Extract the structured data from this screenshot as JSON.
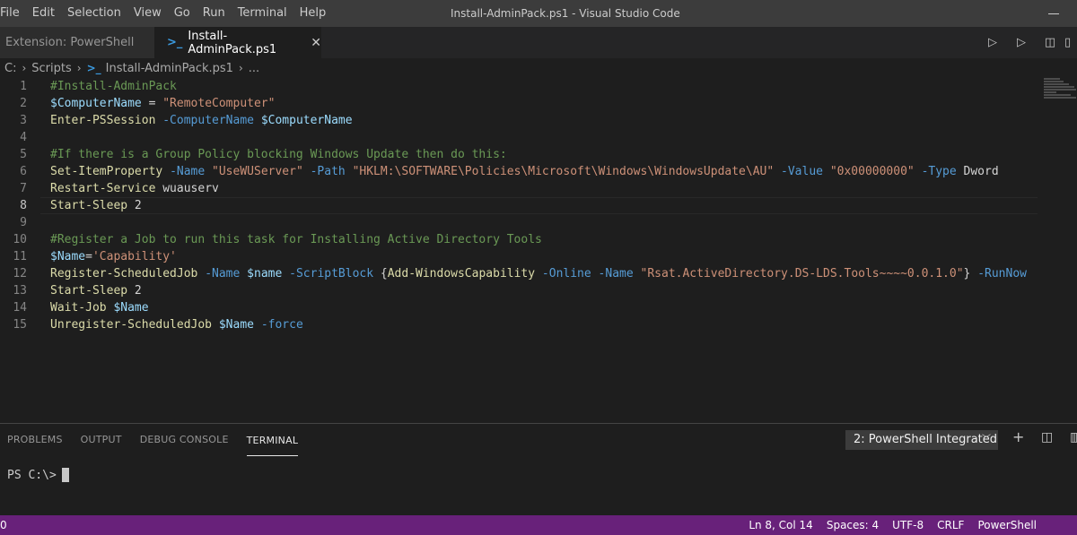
{
  "window": {
    "title": "Install-AdminPack.ps1 - Visual Studio Code",
    "menu": [
      "File",
      "Edit",
      "Selection",
      "View",
      "Go",
      "Run",
      "Terminal",
      "Help"
    ]
  },
  "tabs": [
    {
      "label": "Extension: PowerShell",
      "active": false
    },
    {
      "label": "Install-AdminPack.ps1",
      "active": true
    }
  ],
  "breadcrumb": {
    "drive": "C:",
    "folder": "Scripts",
    "file": "Install-AdminPack.ps1",
    "more": "..."
  },
  "editor": {
    "current_line": 8,
    "lines": [
      {
        "n": "1",
        "tokens": [
          {
            "t": "#Install-AdminPack",
            "c": "comment"
          }
        ]
      },
      {
        "n": "2",
        "tokens": [
          {
            "t": "$ComputerName",
            "c": "var"
          },
          {
            "t": " = ",
            "c": "plain"
          },
          {
            "t": "\"RemoteComputer\"",
            "c": "str"
          }
        ]
      },
      {
        "n": "3",
        "tokens": [
          {
            "t": "Enter-PSSession",
            "c": "cmd"
          },
          {
            "t": " ",
            "c": "plain"
          },
          {
            "t": "-ComputerName",
            "c": "param"
          },
          {
            "t": " ",
            "c": "plain"
          },
          {
            "t": "$ComputerName",
            "c": "var"
          }
        ]
      },
      {
        "n": "4",
        "tokens": []
      },
      {
        "n": "5",
        "tokens": [
          {
            "t": "#If there is a Group Policy blocking Windows Update then do this:",
            "c": "comment"
          }
        ]
      },
      {
        "n": "6",
        "tokens": [
          {
            "t": "Set-ItemProperty",
            "c": "cmd"
          },
          {
            "t": " ",
            "c": "plain"
          },
          {
            "t": "-Name",
            "c": "param"
          },
          {
            "t": " ",
            "c": "plain"
          },
          {
            "t": "\"UseWUServer\"",
            "c": "str"
          },
          {
            "t": " ",
            "c": "plain"
          },
          {
            "t": "-Path",
            "c": "param"
          },
          {
            "t": " ",
            "c": "plain"
          },
          {
            "t": "\"HKLM:\\SOFTWARE\\Policies\\Microsoft\\Windows\\WindowsUpdate\\AU\"",
            "c": "str"
          },
          {
            "t": " ",
            "c": "plain"
          },
          {
            "t": "-Value",
            "c": "param"
          },
          {
            "t": " ",
            "c": "plain"
          },
          {
            "t": "\"0x00000000\"",
            "c": "str"
          },
          {
            "t": " ",
            "c": "plain"
          },
          {
            "t": "-Type",
            "c": "param"
          },
          {
            "t": " Dword",
            "c": "plain"
          }
        ]
      },
      {
        "n": "7",
        "tokens": [
          {
            "t": "Restart-Service",
            "c": "cmd"
          },
          {
            "t": " wuauserv",
            "c": "plain"
          }
        ]
      },
      {
        "n": "8",
        "tokens": [
          {
            "t": "Start-Sleep",
            "c": "cmd"
          },
          {
            "t": " 2",
            "c": "plain"
          }
        ]
      },
      {
        "n": "9",
        "tokens": []
      },
      {
        "n": "10",
        "tokens": [
          {
            "t": "#Register a Job to run this task for Installing Active Directory Tools",
            "c": "comment"
          }
        ]
      },
      {
        "n": "11",
        "tokens": [
          {
            "t": "$Name",
            "c": "var"
          },
          {
            "t": "=",
            "c": "plain"
          },
          {
            "t": "'Capability'",
            "c": "str"
          }
        ]
      },
      {
        "n": "12",
        "tokens": [
          {
            "t": "Register-ScheduledJob",
            "c": "cmd"
          },
          {
            "t": " ",
            "c": "plain"
          },
          {
            "t": "-Name",
            "c": "param"
          },
          {
            "t": " ",
            "c": "plain"
          },
          {
            "t": "$name",
            "c": "var"
          },
          {
            "t": " ",
            "c": "plain"
          },
          {
            "t": "-ScriptBlock",
            "c": "param"
          },
          {
            "t": " {",
            "c": "plain"
          },
          {
            "t": "Add-WindowsCapability",
            "c": "cmd"
          },
          {
            "t": " ",
            "c": "plain"
          },
          {
            "t": "-Online",
            "c": "param"
          },
          {
            "t": " ",
            "c": "plain"
          },
          {
            "t": "-Name",
            "c": "param"
          },
          {
            "t": " ",
            "c": "plain"
          },
          {
            "t": "\"Rsat.ActiveDirectory.DS-LDS.Tools~~~~0.0.1.0\"",
            "c": "str"
          },
          {
            "t": "} ",
            "c": "plain"
          },
          {
            "t": "-RunNow",
            "c": "param"
          }
        ]
      },
      {
        "n": "13",
        "tokens": [
          {
            "t": "Start-Sleep",
            "c": "cmd"
          },
          {
            "t": " 2",
            "c": "plain"
          }
        ]
      },
      {
        "n": "14",
        "tokens": [
          {
            "t": "Wait-Job",
            "c": "cmd"
          },
          {
            "t": " ",
            "c": "plain"
          },
          {
            "t": "$Name",
            "c": "var"
          }
        ]
      },
      {
        "n": "15",
        "tokens": [
          {
            "t": "Unregister-ScheduledJob",
            "c": "cmd"
          },
          {
            "t": " ",
            "c": "plain"
          },
          {
            "t": "$Name",
            "c": "var"
          },
          {
            "t": " ",
            "c": "plain"
          },
          {
            "t": "-force",
            "c": "param"
          }
        ]
      }
    ]
  },
  "panel": {
    "tabs": [
      {
        "label": "PROBLEMS",
        "active": false
      },
      {
        "label": "OUTPUT",
        "active": false
      },
      {
        "label": "DEBUG CONSOLE",
        "active": false
      },
      {
        "label": "TERMINAL",
        "active": true
      }
    ],
    "terminal_select": "2: PowerShell Integrated",
    "prompt": "PS C:\\>"
  },
  "statusbar": {
    "left": "0",
    "position": "Ln 8, Col 14",
    "spaces": "Spaces: 4",
    "encoding": "UTF-8",
    "eol": "CRLF",
    "language": "PowerShell"
  },
  "colors": {
    "statusbar": "#68217a",
    "comment": "#6a9955",
    "variable": "#9cdcfe",
    "string": "#ce9178",
    "command": "#dcdcaa",
    "parameter": "#569cd6"
  },
  "icons": [
    "powershell-icon",
    "close-icon",
    "run-icon",
    "run-selection-icon",
    "split-editor-icon",
    "chevron-down-icon",
    "plus-icon",
    "split-terminal-icon",
    "trash-icon",
    "bell-icon"
  ]
}
